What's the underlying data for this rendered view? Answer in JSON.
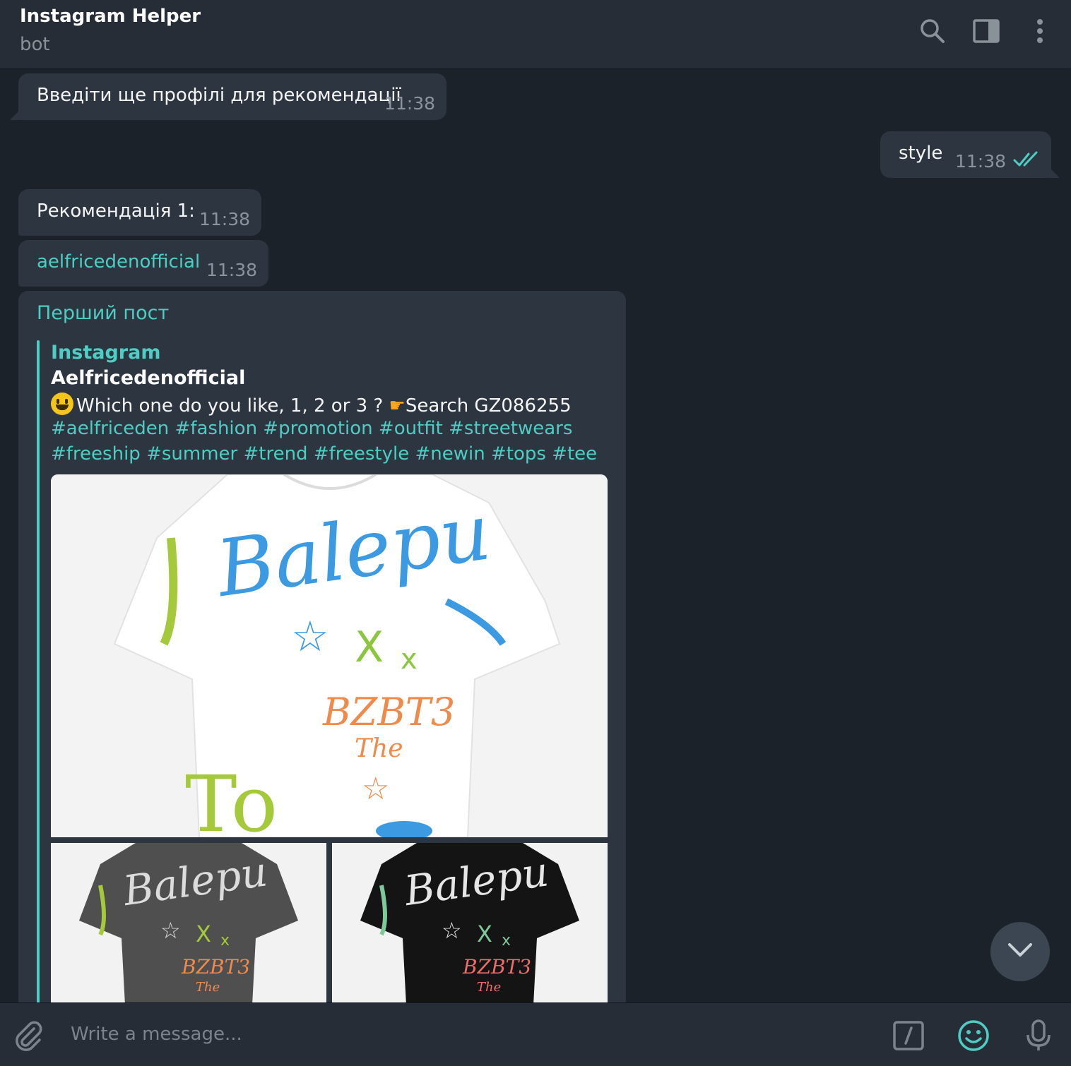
{
  "header": {
    "title": "Instagram Helper",
    "subtitle": "bot"
  },
  "messages": {
    "m1": {
      "text": "Введіти ще профілі для рекомендації",
      "time": "11:38"
    },
    "m2": {
      "text": "style",
      "time": "11:38"
    },
    "m3": {
      "text": "Рекомендація 1:",
      "time": "11:38"
    },
    "m4": {
      "text": "aelfricedenofficial",
      "time": "11:38"
    }
  },
  "post": {
    "heading": "Перший пост",
    "site": "Instagram",
    "title": "Aelfricedenofficial",
    "line1_a": "Which one do you like, 1, 2 or 3 ? ",
    "line1_b": "Search GZ086255",
    "tags1": "#aelfriceden #fashion #promotion #outfit #streetwears",
    "tags2": "#freeship #summer #trend #freestyle #newin #tops #tee",
    "image_text": "Balepu",
    "image_text2": "BZBT3",
    "image_text3": "The"
  },
  "composer": {
    "placeholder": "Write a message..."
  },
  "colors": {
    "accent": "#4ecdc4",
    "bubble": "#2d3540",
    "background": "#1c2229",
    "header": "#262d36"
  },
  "icons": [
    "search-icon",
    "sidebar-icon",
    "more-vertical-icon",
    "attach-icon",
    "bot-command-icon",
    "emoji-icon",
    "microphone-icon",
    "chevron-down-icon",
    "double-check-icon"
  ]
}
